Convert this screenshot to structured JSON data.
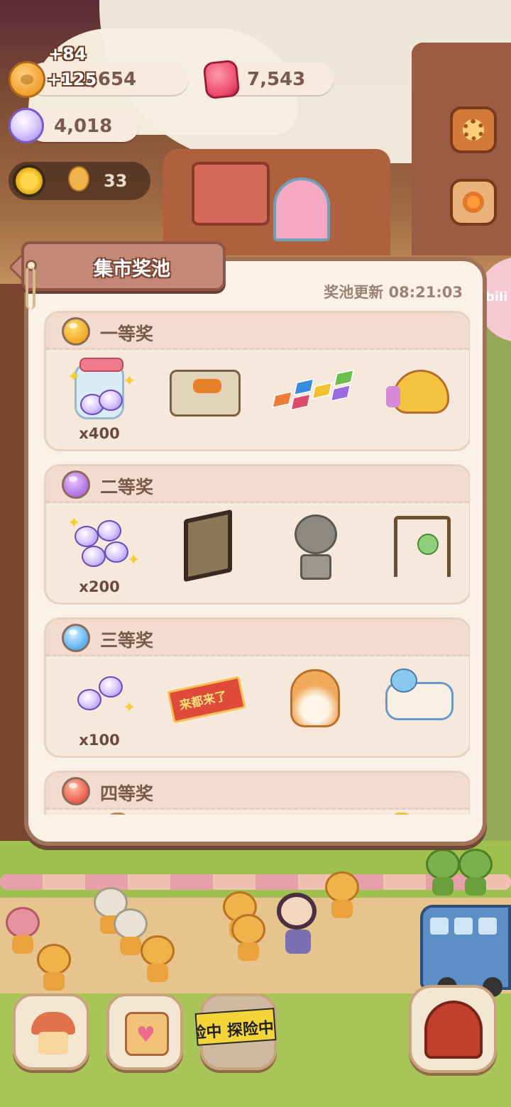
{
  "hud": {
    "coins": {
      "value": ",654",
      "icon": "cookie-coin-icon"
    },
    "rubies": {
      "value": "7,543",
      "icon": "ruby-jelly-icon"
    },
    "candies": {
      "value": "4,018",
      "icon": "crystal-candy-icon"
    },
    "float_gain_1": "+84",
    "float_gain_2": "+125",
    "energy": {
      "value": "33",
      "icon": "sun-icon"
    }
  },
  "side_badge": {
    "label": "bili"
  },
  "modal": {
    "title": "集市奖池",
    "refresh_label": "奖池更新 08:21:03",
    "tiers": [
      {
        "label": "一等奖",
        "orb_color": "#f2a820",
        "items": [
          {
            "name": "candy-jar",
            "qty": "x400"
          },
          {
            "name": "bbq-grill-stall",
            "qty": ""
          },
          {
            "name": "hopscotch-mat",
            "qty": ""
          },
          {
            "name": "toy-plane-ride",
            "qty": ""
          }
        ]
      },
      {
        "label": "二等奖",
        "orb_color": "#b070e0",
        "items": [
          {
            "name": "crystal-candy-pile",
            "qty": "x200"
          },
          {
            "name": "folding-screen",
            "qty": ""
          },
          {
            "name": "stone-poodle-statue",
            "qty": ""
          },
          {
            "name": "hanging-lantern-stall",
            "qty": ""
          }
        ]
      },
      {
        "label": "三等奖",
        "orb_color": "#58aef0",
        "items": [
          {
            "name": "crystal-candy-pair",
            "qty": "x100"
          },
          {
            "name": "red-banner",
            "qty": ""
          },
          {
            "name": "corgi-cushion",
            "qty": ""
          },
          {
            "name": "unicorn-rocker",
            "qty": ""
          }
        ]
      },
      {
        "label": "四等奖",
        "orb_color": "#ee5a4a",
        "items": []
      }
    ],
    "banner_text": "来都来了"
  },
  "nav": {
    "explore_tape": "险中 探险中"
  }
}
